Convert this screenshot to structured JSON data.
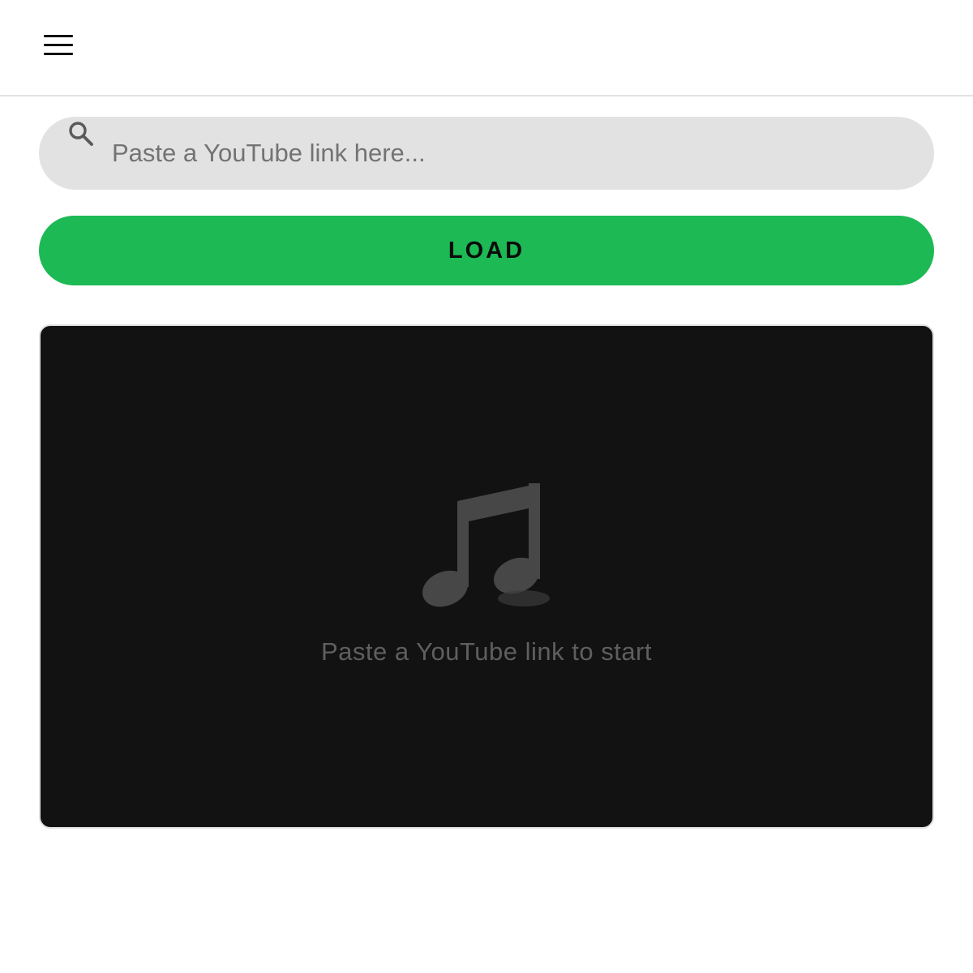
{
  "header": {
    "menu_icon": "hamburger-menu-icon"
  },
  "search": {
    "icon": "search-icon",
    "value": "",
    "placeholder": "Paste a YouTube link here..."
  },
  "load_button": {
    "label": "LOAD",
    "color": "#1db954"
  },
  "player": {
    "background": "#121212",
    "icon": "music-note-icon",
    "empty_message": "Paste a YouTube link to start"
  }
}
